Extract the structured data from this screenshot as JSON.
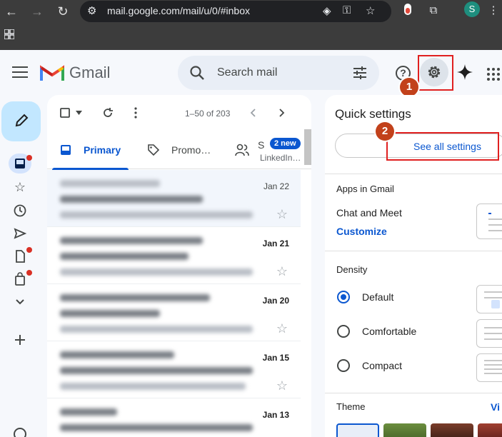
{
  "browser": {
    "url": "mail.google.com/mail/u/0/#inbox",
    "profile_initial": "S"
  },
  "header": {
    "app_name": "Gmail",
    "search_placeholder": "Search mail"
  },
  "annotations": {
    "step1": "1",
    "step2": "2"
  },
  "inbox": {
    "pager": "1–50 of 203",
    "tabs": [
      {
        "label": "Primary"
      },
      {
        "label": "Promo…"
      },
      {
        "label": "S",
        "badge": "2 new",
        "sub": "LinkedIn…"
      }
    ],
    "rows": [
      {
        "date": "Jan 22",
        "read": true
      },
      {
        "date": "Jan 21",
        "read": false
      },
      {
        "date": "Jan 20",
        "read": false
      },
      {
        "date": "Jan 15",
        "read": false
      },
      {
        "date": "Jan 13",
        "read": false
      }
    ]
  },
  "quick_settings": {
    "title": "Quick settings",
    "see_all": "See all settings",
    "apps_heading": "Apps in Gmail",
    "chat_meet": "Chat and Meet",
    "customize": "Customize",
    "density_heading": "Density",
    "density_options": [
      {
        "label": "Default",
        "selected": true
      },
      {
        "label": "Comfortable",
        "selected": false
      },
      {
        "label": "Compact",
        "selected": false
      }
    ],
    "theme_heading": "Theme",
    "theme_link": "Vi"
  },
  "colors": {
    "accent": "#0b57d0",
    "highlight": "#e02020",
    "step_badge": "#c2411b"
  }
}
